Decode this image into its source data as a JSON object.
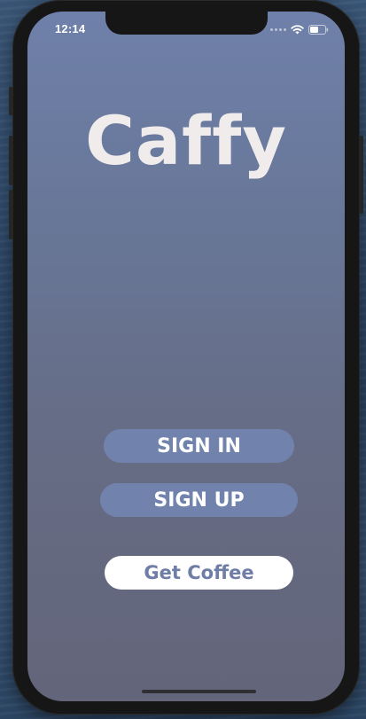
{
  "status_bar": {
    "time": "12:14"
  },
  "app": {
    "title": "Caffy"
  },
  "buttons": {
    "sign_in": "SIGN IN",
    "sign_up": "SIGN UP",
    "get_coffee": "Get Coffee"
  },
  "colors": {
    "screen_top": "#6f80aa",
    "screen_bottom": "#63657a",
    "button_fill": "#7183ad",
    "button_text": "#ffffff",
    "primary_button_fill": "#ffffff",
    "primary_button_text": "#6f7ea6",
    "title_color": "#f1ecec"
  },
  "icons": {
    "signal": "signal-dots-icon",
    "wifi": "wifi-icon",
    "battery": "battery-icon"
  }
}
